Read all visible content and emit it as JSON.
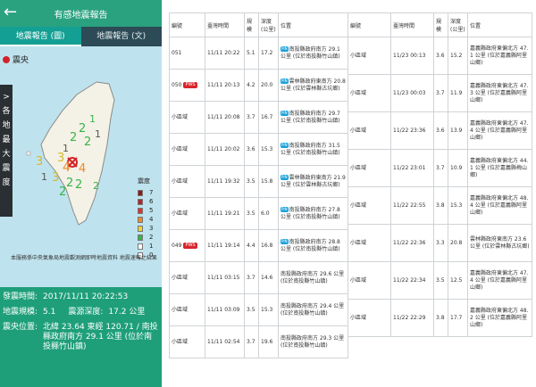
{
  "phone": {
    "title": "有感地震報告",
    "tabs": [
      "地震報告 (圖)",
      "地震報告 (文)"
    ],
    "epicenter_legend": "震央",
    "side_label": [
      ">",
      "各",
      "地",
      "最",
      "大",
      "震",
      "度"
    ],
    "scale_title": "震度",
    "scale": [
      {
        "label": "7",
        "color": "#8b1a1a"
      },
      {
        "label": "6",
        "color": "#b4242a"
      },
      {
        "label": "5",
        "color": "#e0322d"
      },
      {
        "label": "4",
        "color": "#f08a24"
      },
      {
        "label": "3",
        "color": "#f2d22e"
      },
      {
        "label": "2",
        "color": "#37b44a"
      },
      {
        "label": "1",
        "color": "#ffffff"
      },
      {
        "label": "0",
        "color": "#ffffff"
      }
    ],
    "credit": "本服務係中央氣象局地震觀測網即時地震資料 地震速報之結果",
    "map_labels": [
      "1",
      "2",
      "2",
      "2",
      "1",
      "1",
      "3",
      "4",
      "4",
      "3",
      "2",
      "2",
      "2",
      "1",
      "3",
      "2"
    ],
    "info": {
      "time_label": "發震時間:",
      "time_value": "2017/11/11 20:22:53",
      "mag_label": "地震規模:",
      "mag_value": "5.1",
      "depth_label": "震源深度:",
      "depth_value": "17.2 公里",
      "loc_label": "震央位置:",
      "loc_value": "北緯 23.64 東經 120.71 / 南投縣政府南方 29.1 公里 (位於南投縣竹山鎮)"
    }
  },
  "table1": {
    "headers": [
      "編號",
      "臺灣時間",
      "規模",
      "深度(公里)",
      "位置"
    ],
    "rows": [
      {
        "id": "051",
        "pws": "",
        "time": "11/11 20:22",
        "mag": "5.1",
        "depth": "17.2",
        "loc": "南投縣政府南方 29.1 公里 (位於南投縣竹山鎮)",
        "pin": "PIN"
      },
      {
        "id": "050",
        "pws": "PWS",
        "time": "11/11 20:13",
        "mag": "4.2",
        "depth": "20.0",
        "loc": "雲林縣政府東南方 20.8 公里 (位於雲林縣古坑鄉)",
        "pin": "PIN"
      },
      {
        "id": "小區域",
        "pws": "",
        "time": "11/11 20:08",
        "mag": "3.7",
        "depth": "16.7",
        "loc": "南投縣政府南方 29.7 公里 (位於南投縣竹山鎮)",
        "pin": "PIN"
      },
      {
        "id": "小區域",
        "pws": "",
        "time": "11/11 20:02",
        "mag": "3.6",
        "depth": "15.3",
        "loc": "南投縣政府南方 31.5 公里 (位於南投縣竹山鎮)",
        "pin": "PIN"
      },
      {
        "id": "小區域",
        "pws": "",
        "time": "11/11 19:32",
        "mag": "3.5",
        "depth": "15.8",
        "loc": "雲林縣政府東南方 21.9 公里 (位於雲林縣古坑鄉)",
        "pin": "PIN"
      },
      {
        "id": "小區域",
        "pws": "",
        "time": "11/11 19:21",
        "mag": "3.5",
        "depth": "6.0",
        "loc": "南投縣政府南方 27.8 公里 (位於南投縣竹山鎮)",
        "pin": "PIN"
      },
      {
        "id": "049",
        "pws": "PWS",
        "time": "11/11 19:14",
        "mag": "4.4",
        "depth": "16.8",
        "loc": "南投縣政府南方 28.8 公里 (位於南投縣竹山鎮)",
        "pin": "PIN"
      },
      {
        "id": "小區域",
        "pws": "",
        "time": "11/11 03:15",
        "mag": "3.7",
        "depth": "14.6",
        "loc": "南投縣政府南方 29.6 公里 (位於南投縣竹山鎮)",
        "pin": ""
      },
      {
        "id": "小區域",
        "pws": "",
        "time": "11/11 03:09",
        "mag": "3.5",
        "depth": "15.3",
        "loc": "南投縣政府南方 29.4 公里 (位於南投縣竹山鎮)",
        "pin": ""
      },
      {
        "id": "小區域",
        "pws": "",
        "time": "11/11 02:54",
        "mag": "3.7",
        "depth": "19.6",
        "loc": "南投縣政府南方 29.3 公里 (位於南投縣竹山鎮)",
        "pin": ""
      }
    ]
  },
  "table2": {
    "headers": [
      "編號",
      "臺灣時間",
      "規模",
      "深度(公里)",
      "位置"
    ],
    "rows": [
      {
        "id": "小區域",
        "time": "11/23 00:13",
        "mag": "3.6",
        "depth": "15.2",
        "loc": "嘉義縣政府東偏北方 47.1 公里 (位於嘉義縣阿里山鄉)"
      },
      {
        "id": "小區域",
        "time": "11/23 00:03",
        "mag": "3.7",
        "depth": "11.9",
        "loc": "嘉義縣政府東偏北方 47.3 公里 (位於嘉義縣阿里山鄉)"
      },
      {
        "id": "小區域",
        "time": "11/22 23:36",
        "mag": "3.6",
        "depth": "13.9",
        "loc": "嘉義縣政府東偏北方 47.4 公里 (位於嘉義縣阿里山鄉)"
      },
      {
        "id": "小區域",
        "time": "11/22 23:01",
        "mag": "3.7",
        "depth": "10.9",
        "loc": "嘉義縣政府東偏北方 44.1 公里 (位於嘉義縣梅山鄉)"
      },
      {
        "id": "小區域",
        "time": "11/22 22:55",
        "mag": "3.8",
        "depth": "15.3",
        "loc": "嘉義縣政府東偏北方 48.4 公里 (位於嘉義縣阿里山鄉)"
      },
      {
        "id": "小區域",
        "time": "11/22 22:36",
        "mag": "3.3",
        "depth": "20.8",
        "loc": "雲林縣政府東南方 23.6 公里 (位於雲林縣古坑鄉)"
      },
      {
        "id": "小區域",
        "time": "11/22 22:34",
        "mag": "3.5",
        "depth": "12.5",
        "loc": "嘉義縣政府東偏北方 47.4 公里 (位於嘉義縣阿里山鄉)"
      },
      {
        "id": "小區域",
        "time": "11/22 22:29",
        "mag": "3.8",
        "depth": "17.7",
        "loc": "嘉義縣政府東偏北方 48.2 公里 (位於嘉義縣阿里山鄉)"
      }
    ]
  }
}
